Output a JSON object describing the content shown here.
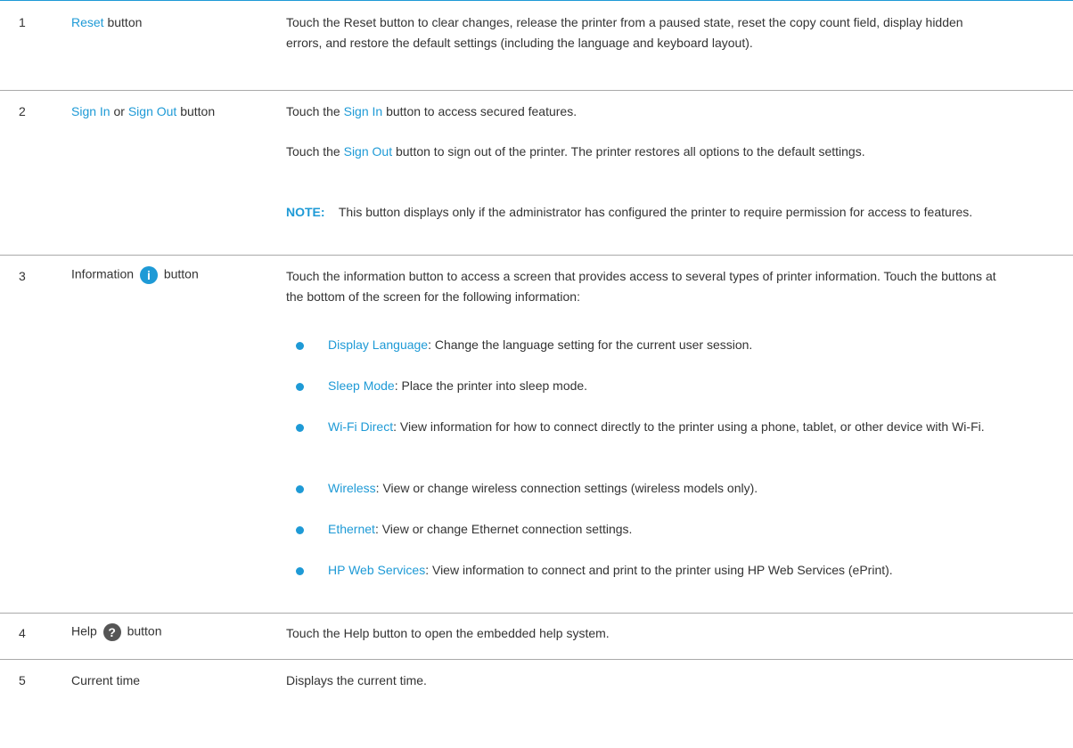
{
  "rows": [
    {
      "num": "1",
      "label_link": "Reset",
      "label_rest": "button",
      "desc": "Touch the Reset button to clear changes, release the printer from a paused state, reset the copy count field, display hidden errors, and restore the default settings (including the language and keyboard layout)."
    },
    {
      "num": "2",
      "label_link1": "Sign In",
      "label_or": "or",
      "label_link2": "Sign Out",
      "label_rest": "button",
      "desc1_pre": "Touch the",
      "desc1_link": "Sign In",
      "desc1_post": "button to access secured features.",
      "desc2_pre": "Touch the",
      "desc2_link": "Sign Out",
      "desc2_post": "button to sign out of the printer. The printer restores all options to the default settings.",
      "note_label": "NOTE:",
      "note_text": "This button displays only if the administrator has configured the printer to require permission for access to features."
    },
    {
      "num": "3",
      "label_pre": "Information",
      "icon": "information-icon",
      "icon_glyph": "i",
      "label_rest": "button",
      "desc": "Touch the information button to access a screen that provides access to several types of printer information. Touch the buttons at the bottom of the screen for the following information:",
      "bullets": [
        {
          "link": "Display Language",
          "text": ": Change the language setting for the current user session."
        },
        {
          "link": "Sleep Mode",
          "text": ": Place the printer into sleep mode."
        },
        {
          "link": "Wi-Fi Direct",
          "text": ": View information for how to connect directly to the printer using a phone, tablet, or other device with Wi-Fi."
        },
        {
          "link": "Wireless",
          "text": ": View or change wireless connection settings (wireless models only)."
        },
        {
          "link": "Ethernet",
          "text": ": View or change Ethernet connection settings."
        },
        {
          "link": "HP Web Services",
          "text": ": View information to connect and print to the printer using HP Web Services (ePrint)."
        }
      ]
    },
    {
      "num": "4",
      "label_pre": "Help",
      "icon": "help-icon",
      "icon_glyph": "?",
      "label_rest": "button",
      "desc": "Touch the Help button to open the embedded help system."
    },
    {
      "num": "5",
      "label": "Current time",
      "desc": "Displays the current time."
    }
  ],
  "colors": {
    "accent": "#1e9ad6",
    "text": "#333333",
    "separator": "#a9a9a9"
  }
}
